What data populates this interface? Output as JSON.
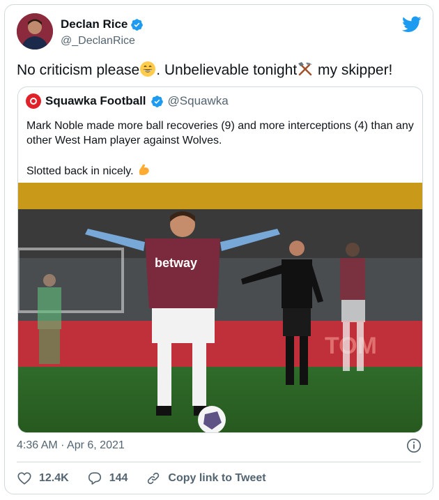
{
  "author": {
    "name": "Declan Rice",
    "handle": "@_DeclanRice"
  },
  "tweet": {
    "text_part1": "No criticism please",
    "text_part2": ". Unbelievable tonight",
    "text_part3": " my skipper!",
    "emoji1": "grinning-face-emoji",
    "emoji2": "hammer-and-pick-emoji"
  },
  "quote": {
    "name": "Squawka Football",
    "handle": "@Squawka",
    "text_line1": "Mark Noble made more ball recoveries (9) and more interceptions (4) than any other West Ham player against Wolves.",
    "text_line2": "Slotted back in nicely.",
    "emoji": "flexed-biceps-emoji",
    "photo": {
      "shirt_sponsor": "betway",
      "board_text": "TOM"
    }
  },
  "meta": {
    "timestamp": "4:36 AM · Apr 6, 2021"
  },
  "actions": {
    "likes": "12.4K",
    "replies": "144",
    "copy_link": "Copy link to Tweet"
  },
  "colors": {
    "twitter_blue": "#1d9bf0",
    "like_text": "#536471",
    "squawka_red": "#e0212a"
  }
}
